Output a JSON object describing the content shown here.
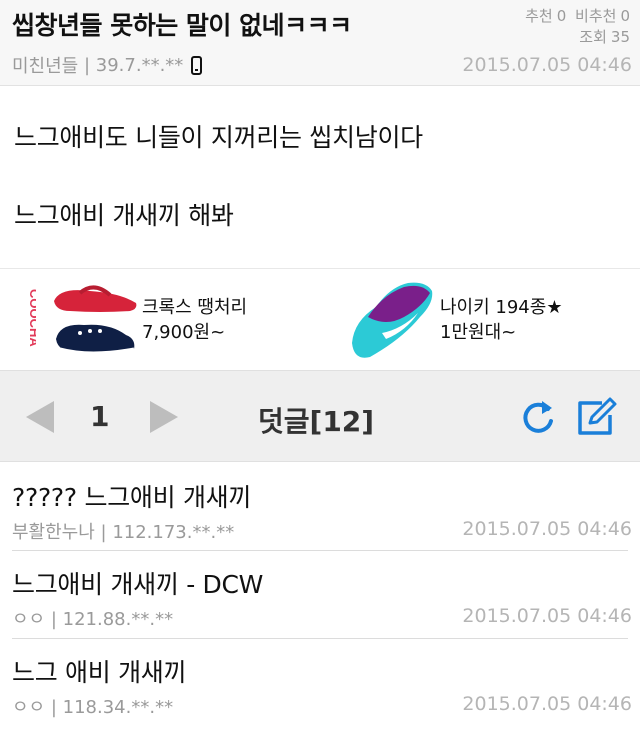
{
  "post": {
    "title": "씹창년들 못하는 말이 없네ㅋㅋㅋ",
    "recommend_label": "추천",
    "recommend_count": "0",
    "not_recommend_label": "비추천",
    "not_recommend_count": "0",
    "views_label": "조회",
    "views_count": "35",
    "author": "미친년들",
    "ip": "39.7.**.**",
    "date": "2015.07.05 04:46",
    "device_icon": "mobile-phone-icon",
    "body": [
      "느그애비도 니들이 지꺼리는 씹치남이다",
      "느그애비 개새끼 해봐"
    ]
  },
  "ad": {
    "brand_logo_text": "COOCHA",
    "items": [
      {
        "name": "크록스 땡처리",
        "price": "7,900원~",
        "icon": "crocs-sandal-image"
      },
      {
        "name": "나이키 194종★",
        "price": "1만원대~",
        "icon": "nike-shoe-image"
      }
    ]
  },
  "pager": {
    "page": "1",
    "comments_label": "덧글[12]",
    "prev_icon": "prev-arrow-icon",
    "next_icon": "next-arrow-icon",
    "refresh_icon": "refresh-icon",
    "write_icon": "write-icon"
  },
  "comments": [
    {
      "text": "????? 느그애비 개새끼",
      "author": "부활한누나",
      "ip": "112.173.**.**",
      "date": "2015.07.05 04:46"
    },
    {
      "text": "느그애비 개새끼 - DCW",
      "author": "ㅇㅇ",
      "ip": "121.88.**.**",
      "date": "2015.07.05 04:46"
    },
    {
      "text": "느그 애비 개새끼",
      "author": "ㅇㅇ",
      "ip": "118.34.**.**",
      "date": "2015.07.05 04:46"
    }
  ],
  "colors": {
    "accent_blue": "#1a7fd9",
    "muted_gray": "#9a9a9a",
    "pager_bg": "#efefef"
  }
}
